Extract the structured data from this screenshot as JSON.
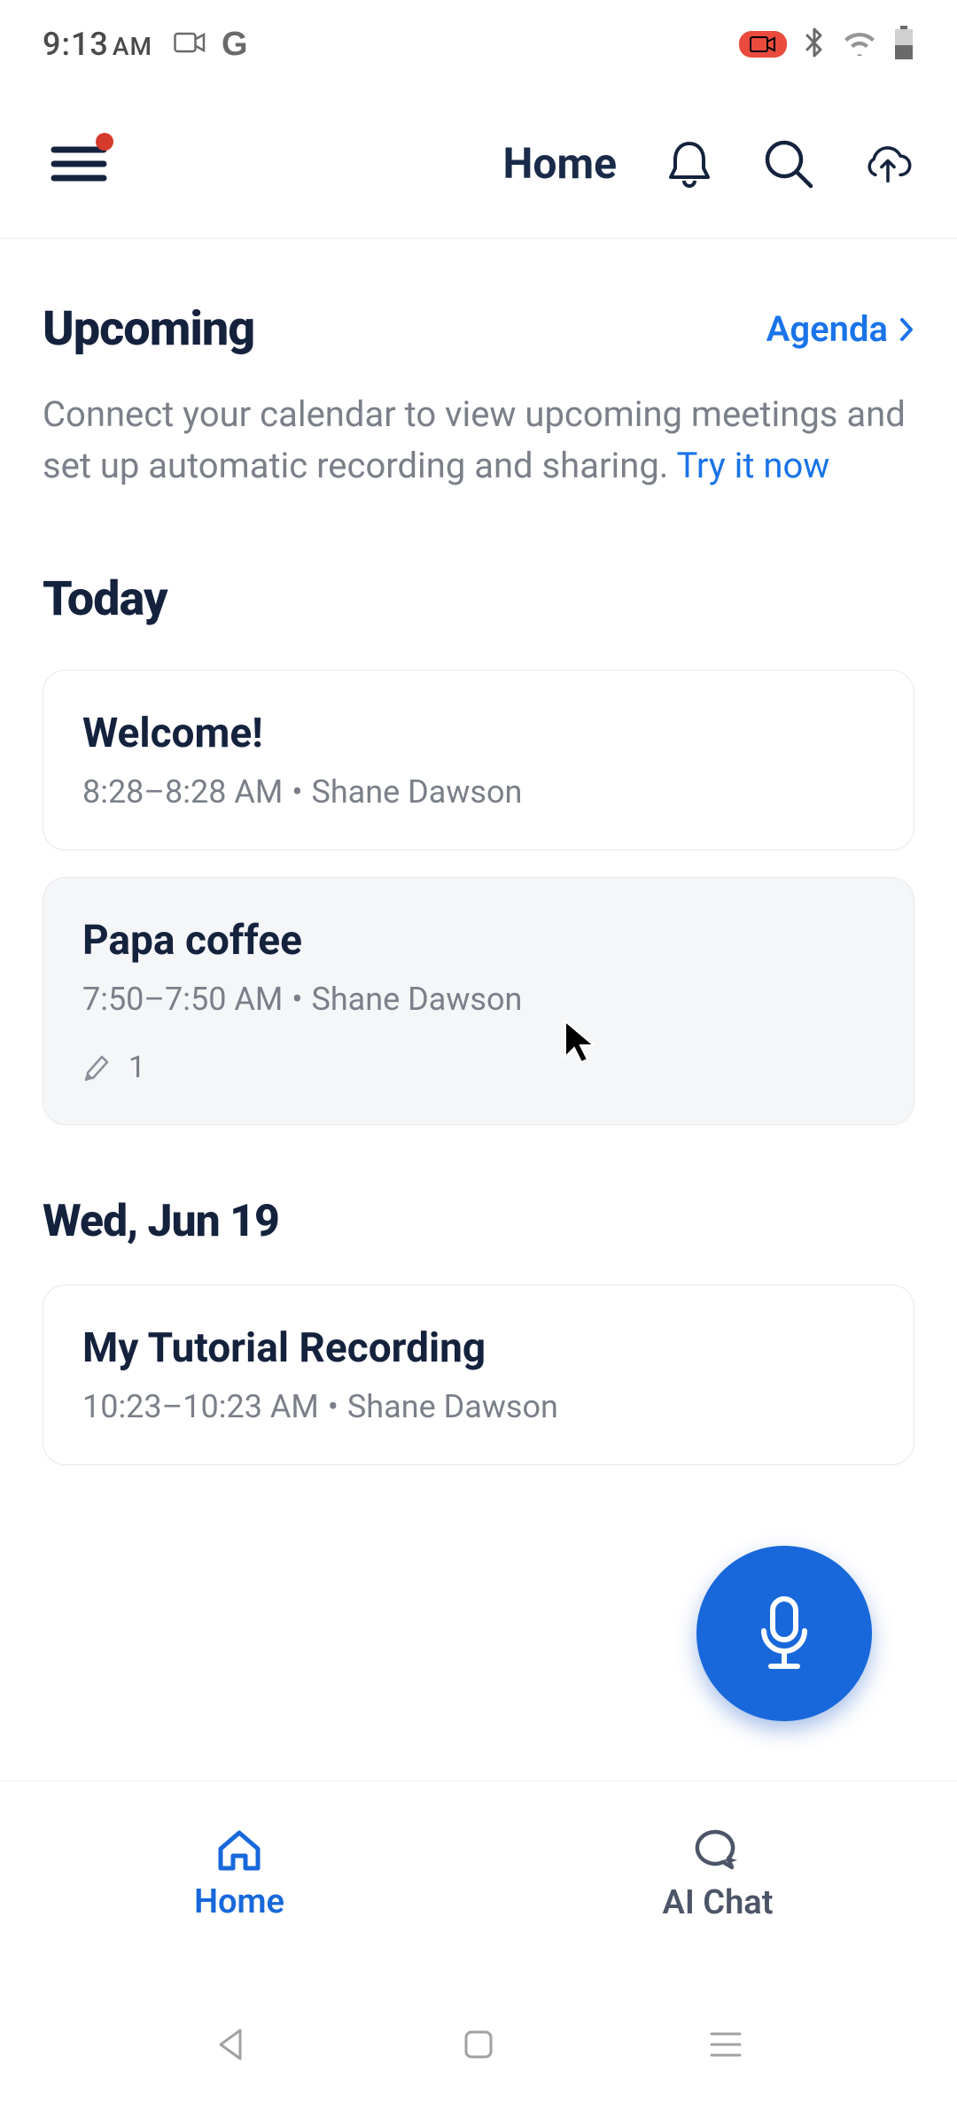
{
  "status_bar": {
    "time": "9:13",
    "ampm": "AM"
  },
  "header": {
    "title": "Home"
  },
  "upcoming": {
    "title": "Upcoming",
    "agenda_label": "Agenda",
    "description_prefix": "Connect your calendar to view upcoming meetings and set up automatic recording and sharing. ",
    "try_link": "Try it now"
  },
  "sections": {
    "today_label": "Today",
    "wed_label": "Wed, Jun 19"
  },
  "cards": {
    "welcome": {
      "title": "Welcome!",
      "time": "8:28–8:28 AM",
      "author": "Shane Dawson"
    },
    "papa": {
      "title": "Papa coffee",
      "time": "7:50–7:50 AM",
      "author": "Shane Dawson",
      "highlight_count": "1"
    },
    "tutorial": {
      "title": "My Tutorial Recording",
      "time": "10:23–10:23 AM",
      "author": "Shane Dawson"
    }
  },
  "bottom_nav": {
    "home": "Home",
    "ai_chat": "AI Chat"
  }
}
